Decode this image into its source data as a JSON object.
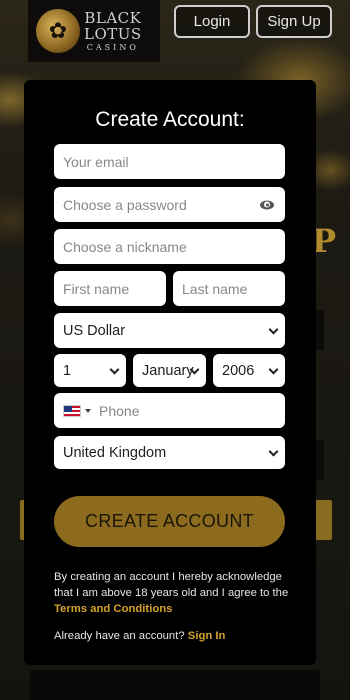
{
  "brand": {
    "line1": "BLACK",
    "line2": "LOTUS",
    "line3": "CASINO",
    "emblem": "lotus-emblem-icon"
  },
  "header": {
    "login_label": "Login",
    "signup_label": "Sign Up"
  },
  "background": {
    "letter": "P"
  },
  "form": {
    "title": "Create Account:",
    "email_placeholder": "Your email",
    "password_placeholder": "Choose a password",
    "nickname_placeholder": "Choose a nickname",
    "first_name_placeholder": "First name",
    "last_name_placeholder": "Last name",
    "currency_value": "US Dollar",
    "dob_day": "1",
    "dob_month": "January",
    "dob_year": "2006",
    "phone_placeholder": "Phone",
    "country_value": "United Kingdom",
    "submit_label": "CREATE ACCOUNT",
    "terms_text": "By creating an account I hereby acknowledge that I am above 18 years old and I agree to the",
    "terms_link": "Terms and Conditions",
    "signin_text": "Already have an account?",
    "signin_link": "Sign In"
  },
  "colors": {
    "accent_gold": "#8c6b1e",
    "link_gold": "#d4a22e",
    "modal_bg": "#000000"
  }
}
